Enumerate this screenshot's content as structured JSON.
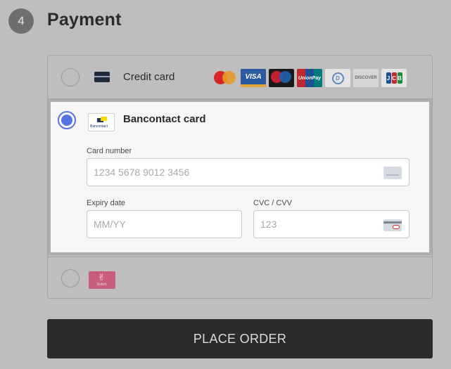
{
  "step": {
    "number": "4",
    "title": "Payment"
  },
  "methods": {
    "credit": {
      "label": "Credit card",
      "selected": false,
      "brands": [
        {
          "name": "mastercard-icon",
          "text": ""
        },
        {
          "name": "visa-icon",
          "text": "VISA"
        },
        {
          "name": "maestro-icon",
          "text": ""
        },
        {
          "name": "unionpay-icon",
          "text": "UnionPay"
        },
        {
          "name": "diners-icon",
          "text": "D"
        },
        {
          "name": "discover-icon",
          "text": "DISCOVER"
        },
        {
          "name": "jcb-icon",
          "text": "JCB"
        }
      ]
    },
    "bancontact": {
      "label": "Bancontact card",
      "logo_text": "Bancontact",
      "selected": true,
      "card_number": {
        "label": "Card number",
        "placeholder": "1234 5678 9012 3456",
        "value": ""
      },
      "expiry": {
        "label": "Expiry date",
        "placeholder": "MM/YY",
        "value": ""
      },
      "cvc": {
        "label": "CVC / CVV",
        "placeholder": "123",
        "value": ""
      }
    },
    "sofort": {
      "logo_text": "Sofort.",
      "selected": false
    }
  },
  "actions": {
    "place_order_label": "PLACE ORDER"
  },
  "colors": {
    "accent": "#5872e2",
    "background": "#bebebe",
    "button": "#2b2b2b"
  }
}
